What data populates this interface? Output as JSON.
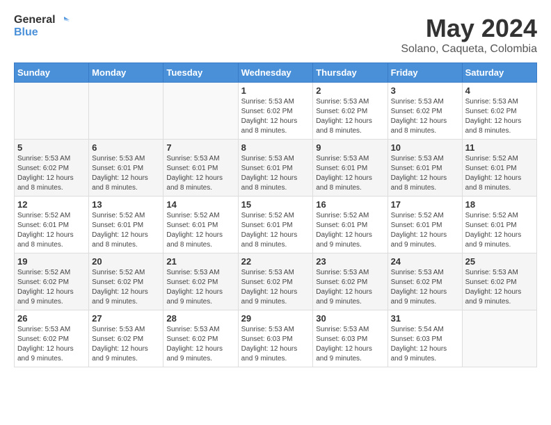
{
  "header": {
    "logo_general": "General",
    "logo_blue": "Blue",
    "month_year": "May 2024",
    "location": "Solano, Caqueta, Colombia"
  },
  "days_of_week": [
    "Sunday",
    "Monday",
    "Tuesday",
    "Wednesday",
    "Thursday",
    "Friday",
    "Saturday"
  ],
  "weeks": [
    [
      {
        "day": "",
        "info": ""
      },
      {
        "day": "",
        "info": ""
      },
      {
        "day": "",
        "info": ""
      },
      {
        "day": "1",
        "info": "Sunrise: 5:53 AM\nSunset: 6:02 PM\nDaylight: 12 hours and 8 minutes."
      },
      {
        "day": "2",
        "info": "Sunrise: 5:53 AM\nSunset: 6:02 PM\nDaylight: 12 hours and 8 minutes."
      },
      {
        "day": "3",
        "info": "Sunrise: 5:53 AM\nSunset: 6:02 PM\nDaylight: 12 hours and 8 minutes."
      },
      {
        "day": "4",
        "info": "Sunrise: 5:53 AM\nSunset: 6:02 PM\nDaylight: 12 hours and 8 minutes."
      }
    ],
    [
      {
        "day": "5",
        "info": "Sunrise: 5:53 AM\nSunset: 6:02 PM\nDaylight: 12 hours and 8 minutes."
      },
      {
        "day": "6",
        "info": "Sunrise: 5:53 AM\nSunset: 6:01 PM\nDaylight: 12 hours and 8 minutes."
      },
      {
        "day": "7",
        "info": "Sunrise: 5:53 AM\nSunset: 6:01 PM\nDaylight: 12 hours and 8 minutes."
      },
      {
        "day": "8",
        "info": "Sunrise: 5:53 AM\nSunset: 6:01 PM\nDaylight: 12 hours and 8 minutes."
      },
      {
        "day": "9",
        "info": "Sunrise: 5:53 AM\nSunset: 6:01 PM\nDaylight: 12 hours and 8 minutes."
      },
      {
        "day": "10",
        "info": "Sunrise: 5:53 AM\nSunset: 6:01 PM\nDaylight: 12 hours and 8 minutes."
      },
      {
        "day": "11",
        "info": "Sunrise: 5:52 AM\nSunset: 6:01 PM\nDaylight: 12 hours and 8 minutes."
      }
    ],
    [
      {
        "day": "12",
        "info": "Sunrise: 5:52 AM\nSunset: 6:01 PM\nDaylight: 12 hours and 8 minutes."
      },
      {
        "day": "13",
        "info": "Sunrise: 5:52 AM\nSunset: 6:01 PM\nDaylight: 12 hours and 8 minutes."
      },
      {
        "day": "14",
        "info": "Sunrise: 5:52 AM\nSunset: 6:01 PM\nDaylight: 12 hours and 8 minutes."
      },
      {
        "day": "15",
        "info": "Sunrise: 5:52 AM\nSunset: 6:01 PM\nDaylight: 12 hours and 8 minutes."
      },
      {
        "day": "16",
        "info": "Sunrise: 5:52 AM\nSunset: 6:01 PM\nDaylight: 12 hours and 9 minutes."
      },
      {
        "day": "17",
        "info": "Sunrise: 5:52 AM\nSunset: 6:01 PM\nDaylight: 12 hours and 9 minutes."
      },
      {
        "day": "18",
        "info": "Sunrise: 5:52 AM\nSunset: 6:01 PM\nDaylight: 12 hours and 9 minutes."
      }
    ],
    [
      {
        "day": "19",
        "info": "Sunrise: 5:52 AM\nSunset: 6:02 PM\nDaylight: 12 hours and 9 minutes."
      },
      {
        "day": "20",
        "info": "Sunrise: 5:52 AM\nSunset: 6:02 PM\nDaylight: 12 hours and 9 minutes."
      },
      {
        "day": "21",
        "info": "Sunrise: 5:53 AM\nSunset: 6:02 PM\nDaylight: 12 hours and 9 minutes."
      },
      {
        "day": "22",
        "info": "Sunrise: 5:53 AM\nSunset: 6:02 PM\nDaylight: 12 hours and 9 minutes."
      },
      {
        "day": "23",
        "info": "Sunrise: 5:53 AM\nSunset: 6:02 PM\nDaylight: 12 hours and 9 minutes."
      },
      {
        "day": "24",
        "info": "Sunrise: 5:53 AM\nSunset: 6:02 PM\nDaylight: 12 hours and 9 minutes."
      },
      {
        "day": "25",
        "info": "Sunrise: 5:53 AM\nSunset: 6:02 PM\nDaylight: 12 hours and 9 minutes."
      }
    ],
    [
      {
        "day": "26",
        "info": "Sunrise: 5:53 AM\nSunset: 6:02 PM\nDaylight: 12 hours and 9 minutes."
      },
      {
        "day": "27",
        "info": "Sunrise: 5:53 AM\nSunset: 6:02 PM\nDaylight: 12 hours and 9 minutes."
      },
      {
        "day": "28",
        "info": "Sunrise: 5:53 AM\nSunset: 6:02 PM\nDaylight: 12 hours and 9 minutes."
      },
      {
        "day": "29",
        "info": "Sunrise: 5:53 AM\nSunset: 6:03 PM\nDaylight: 12 hours and 9 minutes."
      },
      {
        "day": "30",
        "info": "Sunrise: 5:53 AM\nSunset: 6:03 PM\nDaylight: 12 hours and 9 minutes."
      },
      {
        "day": "31",
        "info": "Sunrise: 5:54 AM\nSunset: 6:03 PM\nDaylight: 12 hours and 9 minutes."
      },
      {
        "day": "",
        "info": ""
      }
    ]
  ]
}
